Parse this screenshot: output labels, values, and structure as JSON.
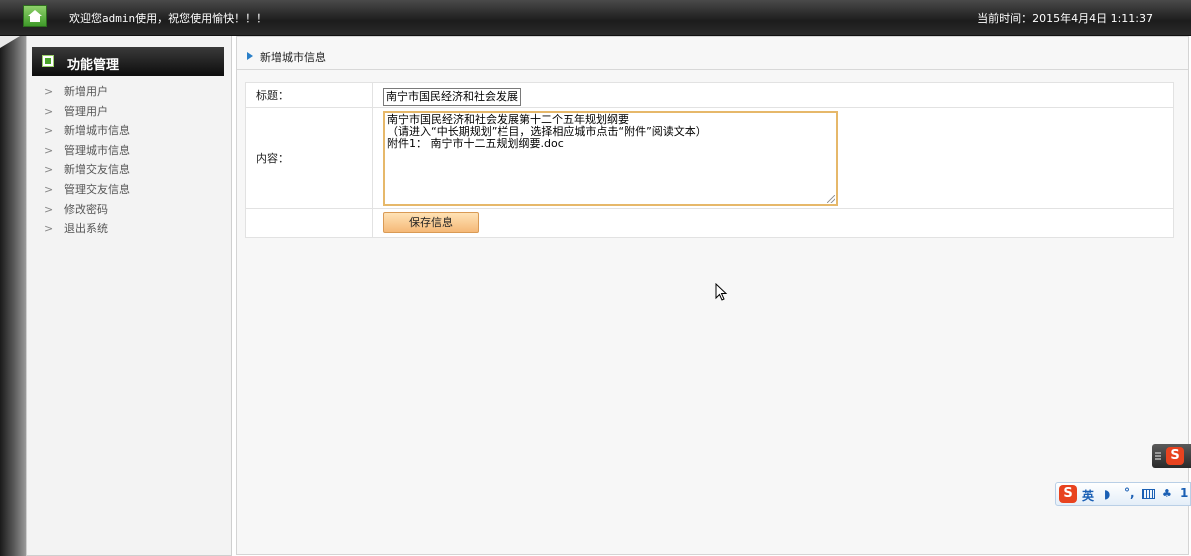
{
  "header": {
    "welcome": "欢迎您admin使用，祝您使用愉快！！！",
    "time_label": "当前时间：",
    "time_value": "2015年4月4日 1:11:37",
    "home_icon": "home-icon"
  },
  "sidebar": {
    "title": "功能管理",
    "items": [
      {
        "label": "新增用户"
      },
      {
        "label": "管理用户"
      },
      {
        "label": "新增城市信息"
      },
      {
        "label": "管理城市信息"
      },
      {
        "label": "新增交友信息"
      },
      {
        "label": "管理交友信息"
      },
      {
        "label": "修改密码"
      },
      {
        "label": "退出系统"
      }
    ]
  },
  "main": {
    "breadcrumb": "新增城市信息",
    "form": {
      "title_label": "标题：",
      "title_value": "南宁市国民经济和社会发展",
      "content_label": "内容：",
      "content_value": "南宁市国民经济和社会发展第十二个五年规划纲要\n（请进入“中长期规划”栏目，选择相应城市点击“附件”阅读文本）\n附件1： 南宁市十二五规划纲要.doc",
      "save_label": "保存信息"
    }
  },
  "ime": {
    "logo": "S",
    "lang": "英",
    "partial": "1"
  },
  "colors": {
    "topbar": "#1c1c1c",
    "textarea_border": "#e6b86a",
    "save_button": "#f5b978",
    "breadcrumb_arrow": "#2a7fc8",
    "ime_logo": "#e8431f"
  }
}
